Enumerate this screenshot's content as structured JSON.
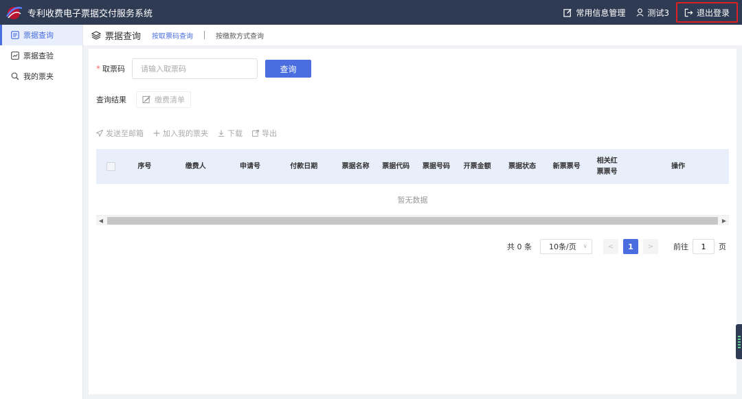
{
  "header": {
    "title": "专利收费电子票据交付服务系统",
    "manage_label": "常用信息管理",
    "user_label": "测试3",
    "logout_label": "退出登录"
  },
  "sidebar": {
    "items": [
      {
        "label": "票据查询",
        "icon": "list-icon",
        "active": true
      },
      {
        "label": "票据查验",
        "icon": "chart-box-icon",
        "active": false
      },
      {
        "label": "我的票夹",
        "icon": "search-icon",
        "active": false
      }
    ]
  },
  "tabs": {
    "section_title": "票据查询",
    "items": [
      {
        "label": "按取票码查询",
        "active": true
      },
      {
        "label": "按缴款方式查询",
        "active": false
      }
    ]
  },
  "form": {
    "required_mark": "*",
    "code_label": "取票码",
    "code_placeholder": "请输入取票码",
    "code_value": "",
    "query_label": "查询"
  },
  "result": {
    "label": "查询结果",
    "fee_list_label": "缴费清单"
  },
  "actions": {
    "send_email": "发送至邮箱",
    "add_folder": "加入我的票夹",
    "download": "下载",
    "export": "导出"
  },
  "table": {
    "columns": [
      "序号",
      "缴费人",
      "申请号",
      "付款日期",
      "票据名称",
      "票据代码",
      "票据号码",
      "开票金额",
      "票据状态",
      "新票票号",
      "相关红票票号",
      "操作"
    ],
    "empty_text": "暂无数据",
    "rows": []
  },
  "pagination": {
    "total": "共 0 条",
    "page_size": "10条/页",
    "current_page": "1",
    "goto_prefix": "前往",
    "goto_value": "1",
    "goto_suffix": "页"
  },
  "colors": {
    "header_bg": "#2f3b52",
    "accent": "#4a6ee0",
    "table_header_bg": "#e9eefb",
    "logout_highlight": "#e02020"
  }
}
